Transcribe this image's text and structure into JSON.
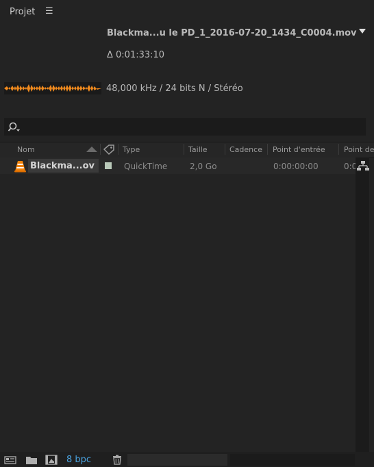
{
  "panel": {
    "title": "Projet",
    "menu_glyph": "☰"
  },
  "preview": {
    "file_name": "Blackma...u le PD_1_2016-07-20_1434_C0004.mov",
    "duration": "Δ 0:01:33:10",
    "audio_info": "48,000 kHz / 24 bits N / Stéréo"
  },
  "columns": [
    "Nom",
    "Type",
    "Taille",
    "Cadence",
    "Point d'entrée",
    "Point de"
  ],
  "rows": [
    {
      "name": "Blackma...ov",
      "type": "QuickTime",
      "size": "2,0 Go",
      "in_point": "0:00:00:00",
      "out_point": "0:0",
      "label_color": "#b9c9b9"
    }
  ],
  "footer": {
    "bpc": "8 bpc"
  },
  "colors": {
    "accent": "#4aa3e0",
    "vlc_orange": "#f0820a",
    "waveform": "#f08a1e"
  }
}
